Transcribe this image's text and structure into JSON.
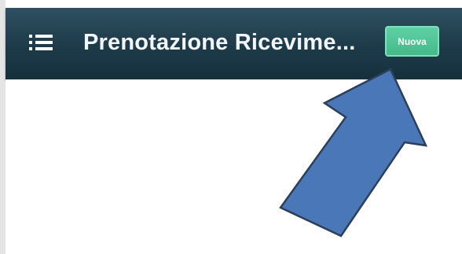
{
  "header": {
    "menu_icon": "hamburger-menu-icon",
    "title": "Prenotazione Ricevime...",
    "new_button_label": "Nuova"
  },
  "colors": {
    "header_background": "#1d3a49",
    "button_accent": "#4fc495",
    "arrow_fill": "#4a77b8",
    "arrow_stroke": "#2c3f5a"
  },
  "annotation": {
    "icon": "pointer-arrow-icon"
  }
}
